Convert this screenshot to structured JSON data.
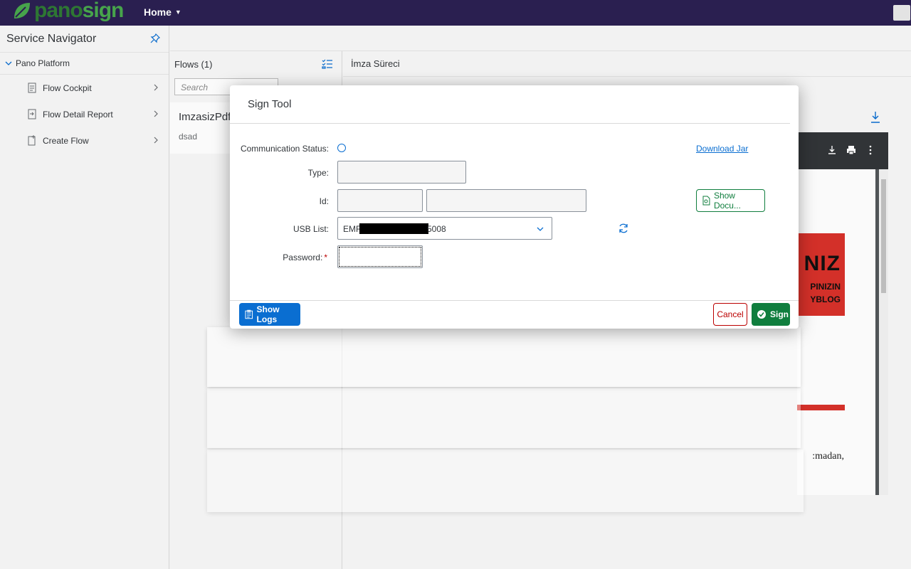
{
  "shell": {
    "logo_pano": "pano",
    "logo_sign": "sign",
    "home_label": "Home",
    "brand_color": "#2b2052"
  },
  "sidenav": {
    "title": "Service Navigator",
    "group": "Pano Platform",
    "items": [
      {
        "label": "Flow Cockpit",
        "icon": "document-icon"
      },
      {
        "label": "Flow Detail Report",
        "icon": "report-icon"
      },
      {
        "label": "Create Flow",
        "icon": "create-document-icon"
      }
    ]
  },
  "flows": {
    "header": "Flows (1)",
    "search_placeholder": "Search",
    "card_title": "ImzasizPdf.p",
    "card_desc": "dsad"
  },
  "process": {
    "header": "İmza Süreci"
  },
  "pdf": {
    "banner_big": "NIZ",
    "banner_line1": "PINIZIN",
    "banner_line2": "YBLOG",
    "body_text": ":madan,"
  },
  "dialog": {
    "title": "Sign Tool",
    "communication_status_label": "Communication Status:",
    "type_label": "Type:",
    "id_label": "Id:",
    "usb_label": "USB List:",
    "usb_prefix": "EMR",
    "usb_suffix": "5008",
    "password_label": "Password:",
    "required_mark": "*",
    "download_link": "Download Jar",
    "show_doc_button": "Show Docu...",
    "show_logs_button": "Show Logs",
    "cancel_button": "Cancel",
    "sign_button": "Sign"
  }
}
